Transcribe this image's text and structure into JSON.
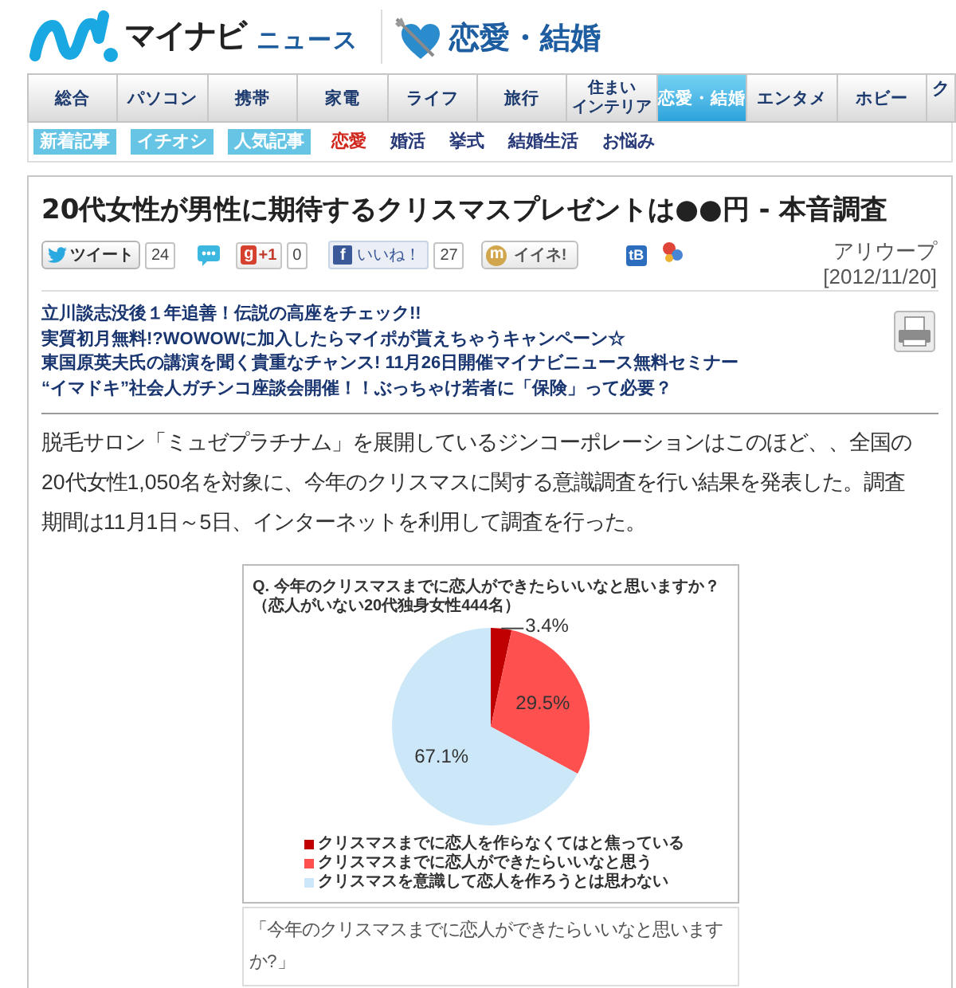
{
  "header": {
    "logo_text": "マイナビ",
    "logo_subtext": "ニュース",
    "section_title": "恋愛・結婚"
  },
  "nav": {
    "tabs": [
      {
        "label": "総合",
        "selected": false
      },
      {
        "label": "パソコン",
        "selected": false
      },
      {
        "label": "携帯",
        "selected": false
      },
      {
        "label": "家電",
        "selected": false
      },
      {
        "label": "ライフ",
        "selected": false
      },
      {
        "label": "旅行",
        "selected": false
      },
      {
        "lines": [
          "住まい",
          "インテリア"
        ],
        "selected": false
      },
      {
        "label": "恋愛・結婚",
        "selected": true
      },
      {
        "label": "エンタメ",
        "selected": false
      },
      {
        "label": "ホビー",
        "selected": false
      },
      {
        "label": "ク",
        "selected": false
      }
    ]
  },
  "subnav": {
    "badges": [
      "新着記事",
      "イチオシ",
      "人気記事"
    ],
    "links": [
      {
        "label": "恋愛",
        "selected": true
      },
      {
        "label": "婚活",
        "selected": false
      },
      {
        "label": "挙式",
        "selected": false
      },
      {
        "label": "結婚生活",
        "selected": false
      },
      {
        "label": "お悩み",
        "selected": false
      }
    ]
  },
  "article": {
    "title": "20代女性が男性に期待するクリスマスプレゼントは●●円 - 本音調査",
    "share": [
      {
        "kind": "tweet",
        "label": "ツイート",
        "count": "24"
      },
      {
        "kind": "comment"
      },
      {
        "kind": "plusone",
        "icon_text": "g",
        "label": "+1",
        "count": "0"
      },
      {
        "kind": "like",
        "icon_text": "f",
        "label": "いいね！",
        "count": "27"
      },
      {
        "kind": "mixi",
        "icon_text": "m",
        "label": "イイネ!"
      },
      {
        "kind": "bookmark",
        "icon_text": "tB"
      },
      {
        "kind": "clip"
      }
    ],
    "source": "アリウープ",
    "date": "[2012/11/20]",
    "promo_links": [
      "立川談志没後１年追善！伝説の高座をチェック!!",
      "実質初月無料!?WOWOWに加入したらマイポが貰えちゃうキャンペーン☆",
      "東国原英夫氏の講演を聞く貴重なチャンス! 11月26日開催マイナビニュース無料セミナー",
      "“イマドキ”社会人ガチンコ座談会開催！！ぶっちゃけ若者に「保険」って必要？"
    ],
    "body": "脱毛サロン「ミュゼプラチナム」を展開しているジンコーポレーションはこのほど、、全国の20代女性1,050名を対象に、今年のクリスマスに関する意識調査を行い結果を発表した。調査期間は11月1日～5日、インターネットを利用して調査を行った。",
    "figure": {
      "subtitle": "（恋人がいない20代独身女性444名）",
      "chart_data": {
        "type": "pie",
        "title": "Q. 今年のクリスマスまでに恋人ができたらいいなと思いますか？",
        "categories": [
          "クリスマスまでに恋人を作らなくてはと焦っている",
          "クリスマスまでに恋人ができたらいいなと思う",
          "クリスマスを意識して恋人を作ろうとは思わない"
        ],
        "values": [
          3.4,
          29.5,
          67.1
        ],
        "colors": [
          "#c00000",
          "#ff5050",
          "#cce8f8"
        ],
        "value_labels": [
          "3.4%",
          "29.5%",
          "67.1%"
        ],
        "legend": "bottom"
      }
    },
    "caption": "「今年のクリスマスまでに恋人ができたらいいなと思いますか?」"
  }
}
